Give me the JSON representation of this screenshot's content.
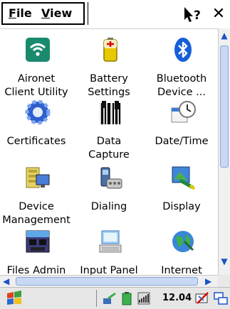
{
  "menu": {
    "file": {
      "accel": "F",
      "rest": "ile"
    },
    "view": {
      "accel": "V",
      "rest": "iew"
    }
  },
  "titlebar": {
    "help_label": "?",
    "close_label": "✕"
  },
  "items": [
    {
      "label_line1": "Aironet",
      "label_line2": "Client Utility",
      "icon": "aironet-wifi-icon"
    },
    {
      "label_line1": "Battery",
      "label_line2": "Settings",
      "icon": "battery-icon"
    },
    {
      "label_line1": "Bluetooth",
      "label_line2": "Device ...",
      "icon": "bluetooth-icon"
    },
    {
      "label_line1": "Certificates",
      "label_line2": "",
      "icon": "certificates-icon"
    },
    {
      "label_line1": "Data",
      "label_line2": "Capture",
      "icon": "data-capture-icon"
    },
    {
      "label_line1": "Date/Time",
      "label_line2": "",
      "icon": "date-time-icon"
    },
    {
      "label_line1": "Device",
      "label_line2": "Management",
      "icon": "device-management-icon"
    },
    {
      "label_line1": "Dialing",
      "label_line2": "",
      "icon": "dialing-icon"
    },
    {
      "label_line1": "Display",
      "label_line2": "",
      "icon": "display-icon"
    },
    {
      "label_line1": "Files Admin",
      "label_line2": "",
      "icon": "files-admin-icon"
    },
    {
      "label_line1": "Input Panel",
      "label_line2": "",
      "icon": "input-panel-icon"
    },
    {
      "label_line1": "Internet",
      "label_line2": "",
      "icon": "internet-icon"
    }
  ],
  "taskbar": {
    "time": "12.04"
  },
  "colors": {
    "accent": "#1a54c8",
    "wifi_green": "#1a8a6e",
    "battery_yellow": "#e8c800",
    "bluetooth_blue": "#1560d8"
  }
}
